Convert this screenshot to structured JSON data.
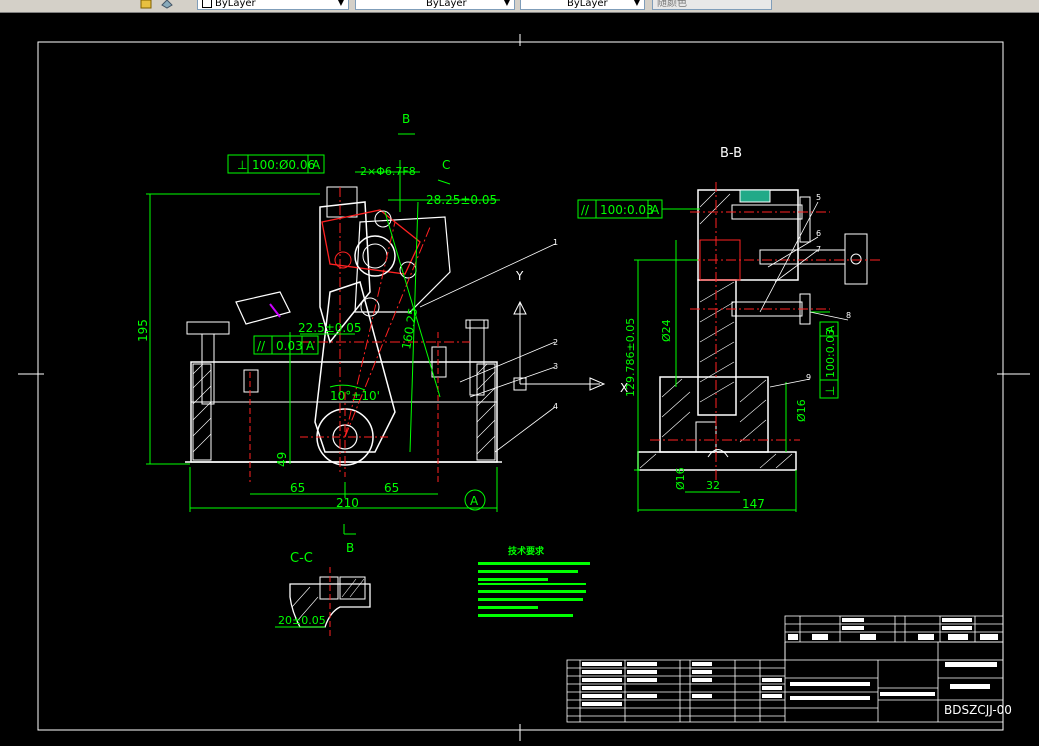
{
  "toolbar": {
    "layer_combo": "ByLayer",
    "linetype_combo": "ByLayer",
    "lineweight_combo": "ByLayer",
    "color_combo": "随颜色"
  },
  "drawing": {
    "section_bb": "B-B",
    "section_cc": "C-C",
    "label_b_top": "B",
    "label_c_top": "C",
    "label_b_bottom": "B",
    "tol_perp_1": "100:Ø0.06",
    "tol_perp_1_ref": "A",
    "tol_parallel_1": "0.03",
    "tol_parallel_1_ref": "A",
    "tol_parallel_2": "100:0.03",
    "tol_parallel_2_ref": "A",
    "tol_perp_2": "100:0.03",
    "tol_perp_2_ref": "A",
    "dim_holes": "2×Φ6.7F8",
    "dim_2825": "28.25±0.05",
    "dim_225": "22.5±0.05",
    "dim_16025": "160.25",
    "dim_angle": "10°±10'",
    "dim_195": "195",
    "dim_49": "49",
    "dim_65a": "65",
    "dim_65b": "65",
    "dim_210": "210",
    "datum_a": "A",
    "dim_24": "Ø24",
    "dim_129": "129.786±0.05",
    "dim_16a": "Ø16",
    "dim_16b": "Ø16",
    "dim_32": "32",
    "dim_147": "147",
    "dim_20": "20±0.05",
    "leader_1": "1",
    "leader_2": "2",
    "leader_3": "3",
    "leader_4": "4",
    "leader_5": "5",
    "leader_6": "6",
    "leader_7": "7",
    "leader_8": "8",
    "leader_9": "9",
    "axis_y": "Y",
    "axis_x": "X",
    "tech_title": "技术要求",
    "drawing_number": "BDSZCJJ-00"
  }
}
